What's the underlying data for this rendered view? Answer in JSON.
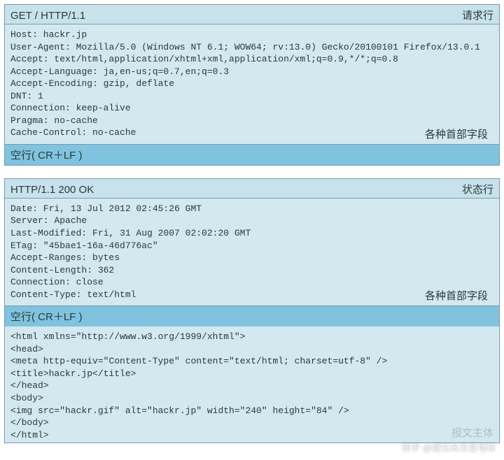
{
  "request": {
    "start_line": "GET / HTTP/1.1",
    "start_line_label": "请求行",
    "headers": [
      "Host: hackr.jp",
      "User-Agent: Mozilla/5.0 (Windows NT 6.1; WOW64; rv:13.0) Gecko/20100101 Firefox/13.0.1",
      "Accept: text/html,application/xhtml+xml,application/xml;q=0.9,*/*;q=0.8",
      "Accept-Language: ja,en-us;q=0.7,en;q=0.3",
      "Accept-Encoding: gzip, deflate",
      "DNT: 1",
      "Connection: keep-alive",
      "Pragma: no-cache",
      "Cache-Control: no-cache"
    ],
    "headers_label": "各种首部字段",
    "empty_line_label": "空行( CR＋LF )"
  },
  "response": {
    "status_line": "HTTP/1.1 200 OK",
    "status_line_label": "状态行",
    "headers": [
      "Date: Fri, 13 Jul 2012 02:45:26 GMT",
      "Server: Apache",
      "Last-Modified: Fri, 31 Aug 2007 02:02:20 GMT",
      "ETag: \"45bae1-16a-46d776ac\"",
      "Accept-Ranges: bytes",
      "Content-Length: 362",
      "Connection: close",
      "Content-Type: text/html"
    ],
    "headers_label": "各种首部字段",
    "empty_line_label": "空行( CR＋LF )",
    "body": [
      "<html xmlns=\"http://www.w3.org/1999/xhtml\">",
      "<head>",
      "<meta http-equiv=\"Content-Type\" content=\"text/html; charset=utf-8\" />",
      "<title>hackr.jp</title>",
      "</head>",
      "<body>",
      "<img src=\"hackr.gif\" alt=\"hackr.jp\" width=\"240\" height=\"84\" />",
      "</body>",
      "</html>"
    ],
    "body_label": "报文主体"
  },
  "watermark": "知乎 @提拉米苏爱地球"
}
